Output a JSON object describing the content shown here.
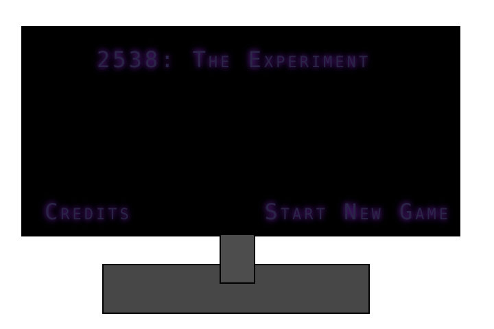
{
  "game": {
    "title": "2538: The Experiment",
    "menu": {
      "credits_label": "Credits",
      "start_label": "Start New Game"
    }
  },
  "colors": {
    "screen_background": "#000000",
    "text": "#2a2446",
    "glow": "#5a1f8a",
    "monitor_stand": "#474747"
  }
}
